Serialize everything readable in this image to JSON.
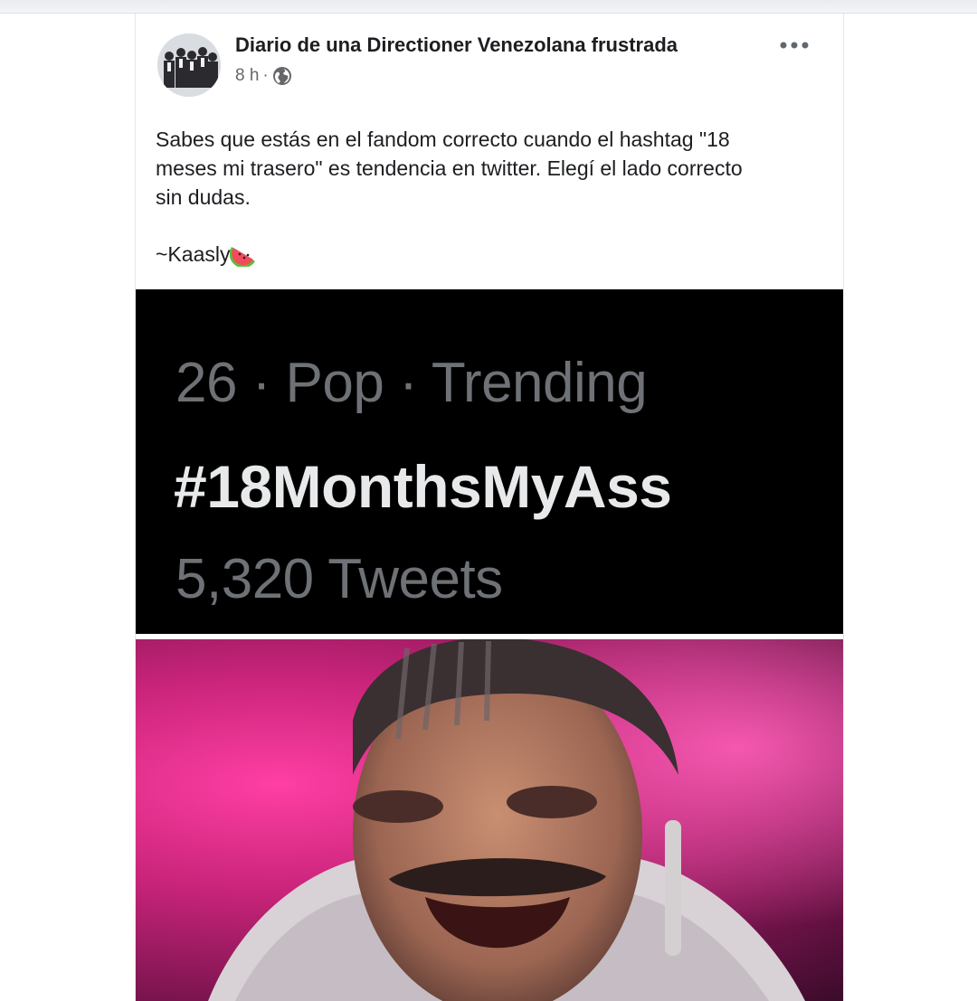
{
  "post": {
    "author": "Diario de una Directioner Venezolana frustrada",
    "time": "8 h",
    "separator": "·",
    "privacy_icon": "globe-icon",
    "more_icon": "more-options-icon",
    "text_lines": [
      "Sabes que estás en el fandom correcto cuando el hashtag \"18",
      "meses mi trasero\" es tendencia en twitter. Elegí el lado correcto",
      "sin dudas."
    ],
    "signature": "~Kaasly",
    "signature_emoji": "watermelon-icon"
  },
  "trend": {
    "meta": "26 · Pop · Trending",
    "hashtag": "#18MonthsMyAss",
    "count": "5,320 Tweets"
  },
  "colors": {
    "author": "#1c1e21",
    "meta": "#65676b",
    "trend_bg": "#000000",
    "trend_muted": "#6e7175",
    "trend_text": "#e7e9ea",
    "photo_pink": "#ff3fa4"
  }
}
